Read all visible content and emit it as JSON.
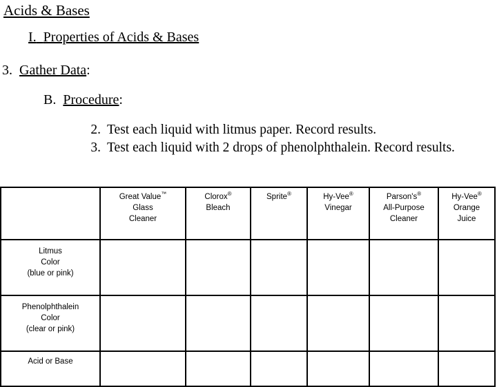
{
  "document": {
    "heading_title": "Acids & Bases",
    "section_roman": "I.",
    "section_title": "Properties of Acids & Bases",
    "step3_num": "3.",
    "step3_label": "Gather Data",
    "step3_colon": ":",
    "sub_b_num": "B.",
    "sub_b_label": "Procedure",
    "sub_b_colon": ":",
    "procedure_steps": [
      {
        "num": "2.",
        "text": "Test each liquid with litmus paper.  Record results."
      },
      {
        "num": "3.",
        "text": "Test each liquid with 2 drops of phenolphthalein.  Record results."
      }
    ]
  },
  "chart_data": {
    "type": "table",
    "title": "Acids & Bases data collection table",
    "columns": [
      {
        "key": "label",
        "header_lines": []
      },
      {
        "key": "gv",
        "header_lines": [
          "Great Value™",
          "Glass",
          "Cleaner"
        ]
      },
      {
        "key": "clorox",
        "header_lines": [
          "Clorox®",
          "Bleach"
        ]
      },
      {
        "key": "sprite",
        "header_lines": [
          "Sprite®"
        ]
      },
      {
        "key": "hyvee1",
        "header_lines": [
          "Hy-Vee®",
          "Vinegar"
        ]
      },
      {
        "key": "parson",
        "header_lines": [
          "Parson's®",
          "All-Purpose",
          "Cleaner"
        ]
      },
      {
        "key": "hyvee2",
        "header_lines": [
          "Hy-Vee®",
          "Orange",
          "Juice"
        ]
      }
    ],
    "rows": [
      {
        "label_lines": [
          "Litmus",
          "Color",
          "(blue or pink)"
        ],
        "values": [
          "",
          "",
          "",
          "",
          "",
          ""
        ]
      },
      {
        "label_lines": [
          "Phenolphthalein",
          "Color",
          "(clear or pink)"
        ],
        "values": [
          "",
          "",
          "",
          "",
          "",
          ""
        ]
      },
      {
        "label_lines": [
          "Acid or Base"
        ],
        "values": [
          "",
          "",
          "",
          "",
          "",
          ""
        ]
      }
    ]
  },
  "table": {
    "header": {
      "corner": "",
      "gv_line1": "Great Value",
      "gv_sup1": "™",
      "gv_line2": "Glass",
      "gv_line3": "Cleaner",
      "clorox_line1": "Clorox",
      "clorox_sup1": "®",
      "clorox_line2": "Bleach",
      "sprite_line1": "Sprite",
      "sprite_sup1": "®",
      "hyvee1_line1": "Hy-Vee",
      "hyvee1_sup1": "®",
      "hyvee1_line2": "Vinegar",
      "parson_line1": "Parson's",
      "parson_sup1": "®",
      "parson_line2": "All-Purpose",
      "parson_line3": "Cleaner",
      "hyvee2_line1": "Hy-Vee",
      "hyvee2_sup1": "®",
      "hyvee2_line2": "Orange",
      "hyvee2_line3": "Juice"
    },
    "rows": {
      "litmus_l1": "Litmus",
      "litmus_l2": "Color",
      "litmus_l3": "(blue or pink)",
      "phenol_l1": "Phenolphthalein",
      "phenol_l2": "Color",
      "phenol_l3": "(clear or pink)",
      "acidbase_l1": "Acid or Base",
      "empty": ""
    }
  }
}
